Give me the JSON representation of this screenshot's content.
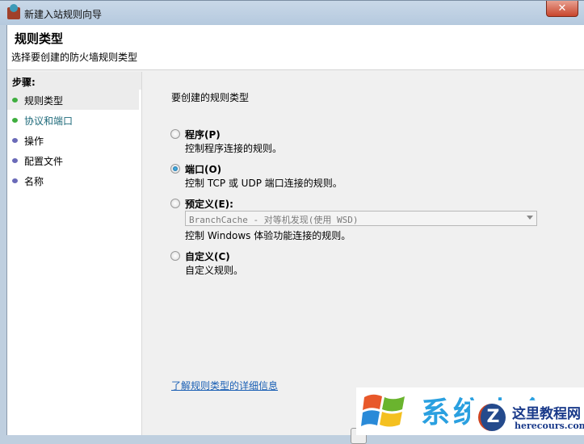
{
  "window": {
    "title": "新建入站规则向导",
    "close": "✕"
  },
  "header": {
    "title": "规则类型",
    "subtitle": "选择要创建的防火墙规则类型"
  },
  "steps": {
    "heading": "步骤:",
    "items": [
      {
        "label": "规则类型",
        "state": "done"
      },
      {
        "label": "协议和端口",
        "state": "done"
      },
      {
        "label": "操作",
        "state": "pending"
      },
      {
        "label": "配置文件",
        "state": "pending"
      },
      {
        "label": "名称",
        "state": "pending"
      }
    ]
  },
  "main": {
    "question": "要创建的规则类型",
    "options": [
      {
        "label": "程序(P)",
        "desc": "控制程序连接的规则。",
        "selected": false
      },
      {
        "label": "端口(O)",
        "desc": "控制 TCP 或 UDP 端口连接的规则。",
        "selected": true
      },
      {
        "label": "预定义(E):",
        "select_value": "BranchCache - 对等机发现(使用 WSD)",
        "desc": "控制 Windows 体验功能连接的规则。",
        "selected": false
      },
      {
        "label": "自定义(C)",
        "desc": "自定义规则。",
        "selected": false
      }
    ],
    "link": "了解规则类型的详细信息"
  },
  "watermark": {
    "logo_text": "系统大全",
    "badge_text": "这里教程网",
    "badge_url": "herecours.com",
    "badge_letter": "Z"
  }
}
